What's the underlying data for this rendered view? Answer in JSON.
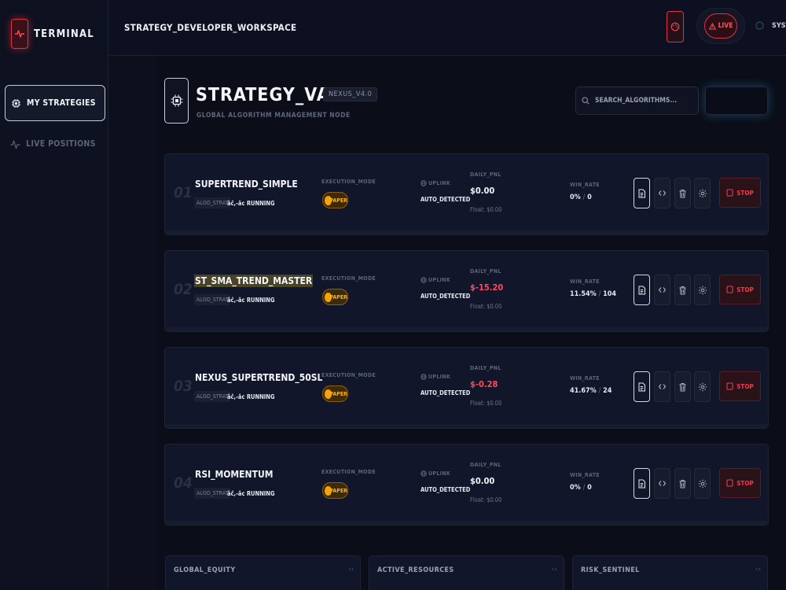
{
  "app": {
    "logo_text": "TERMINAL"
  },
  "sidebar": {
    "items": [
      {
        "label": "MY STRATEGIES",
        "active": true,
        "icon": "cpu-icon"
      },
      {
        "label": "LIVE POSITIONS",
        "active": false,
        "icon": "activity-icon"
      }
    ]
  },
  "topbar": {
    "workspace_title": "STRATEGY_DEVELOPER_WORKSPACE",
    "live_label": "LIVE",
    "system_label": "SYSTE"
  },
  "header": {
    "title": "STRATEGY_VAULT",
    "version": "NEXUS_V4.0",
    "subtitle": "GLOBAL ALGORITHM MANAGEMENT NODE",
    "search_placeholder": "SEARCH_ALGORITHMS..."
  },
  "labels": {
    "execution_mode": "EXECUTION_MODE",
    "uplink": "UPLINK",
    "daily_pnl": "DAILY_PNL",
    "win_rate": "WIN_RATE",
    "stop": "STOP"
  },
  "strategies": [
    {
      "num": "01",
      "name": "SUPERTREND_SIMPLE",
      "tag": "ALGO_STRAT",
      "status": "âĉ,-âc RUNNING",
      "mode": "PAPER",
      "uplink": "AUTO_DETECTED",
      "pnl": "$0.00",
      "pnl_negative": false,
      "float": "Float: $0.00",
      "win_rate": "0%",
      "trades": "0",
      "highlighted": false
    },
    {
      "num": "02",
      "name": "ST_SMA_TREND_MASTER",
      "tag": "ALGO_STRAT",
      "status": "âĉ,-âc RUNNING",
      "mode": "PAPER",
      "uplink": "AUTO_DETECTED",
      "pnl": "$-15.20",
      "pnl_negative": true,
      "float": "Float: $0.00",
      "win_rate": "11.54%",
      "trades": "104",
      "highlighted": true
    },
    {
      "num": "03",
      "name": "NEXUS_SUPERTREND_50SL",
      "tag": "ALGO_STRAT",
      "status": "âĉ,-âc RUNNING",
      "mode": "PAPER",
      "uplink": "AUTO_DETECTED",
      "pnl": "$-0.28",
      "pnl_negative": true,
      "float": "Float: $0.00",
      "win_rate": "41.67%",
      "trades": "24",
      "highlighted": false
    },
    {
      "num": "04",
      "name": "RSI_MOMENTUM",
      "tag": "ALGO_STRAT",
      "status": "âĉ,-âc RUNNING",
      "mode": "PAPER",
      "uplink": "AUTO_DETECTED",
      "pnl": "$0.00",
      "pnl_negative": false,
      "float": "Float: $0.00",
      "win_rate": "0%",
      "trades": "0",
      "highlighted": false
    }
  ],
  "panels": [
    {
      "title": "GLOBAL_EQUITY",
      "chevron": "‹ ›"
    },
    {
      "title": "ACTIVE_RESOURCES",
      "chevron": "‹ ›"
    },
    {
      "title": "RISK_SENTINEL",
      "chevron": "‹ ›"
    }
  ],
  "colors": {
    "accent_red": "#e0313f",
    "paper_orange": "#f5a30a",
    "negative_pnl": "#ff4a5a",
    "background": "#0b0e19"
  }
}
